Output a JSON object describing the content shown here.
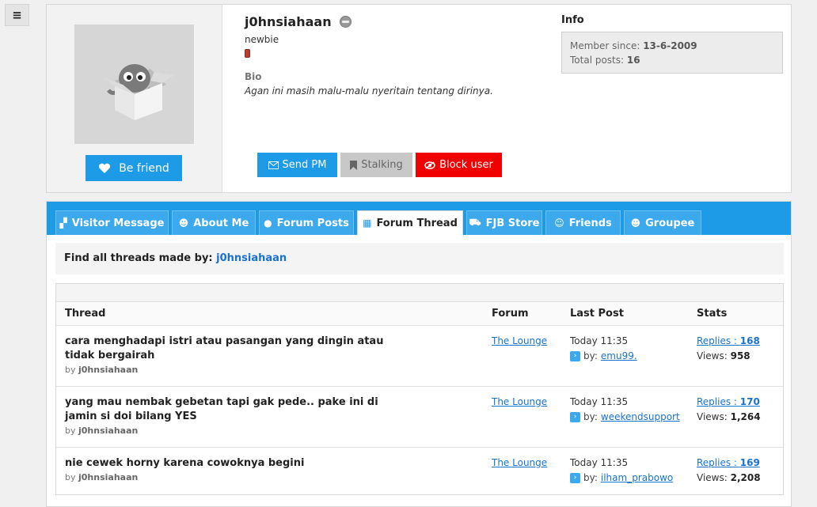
{
  "menu_icon": "menu-icon",
  "profile": {
    "username": "j0hnsiahaan",
    "rank": "newbie",
    "bio_label": "Bio",
    "bio_text": "Agan ini masih malu-malu nyeritain tentang dirinya.",
    "befriend_label": "Be friend",
    "actions": {
      "send_pm": "Send PM",
      "stalking": "Stalking",
      "block_user": "Block user"
    },
    "info_title": "Info",
    "member_since_label": "Member since: ",
    "member_since": "13-6-2009",
    "total_posts_label": "Total posts: ",
    "total_posts": "16",
    "colors": {
      "primary": "#1e9be6",
      "block": "#f00000",
      "stalk": "#c8c8c8"
    }
  },
  "tabs": [
    {
      "label": "Visitor Message",
      "icon": "message-icon"
    },
    {
      "label": "About Me",
      "icon": "user-icon"
    },
    {
      "label": "Forum Posts",
      "icon": "chat-icon"
    },
    {
      "label": "Forum Thread",
      "icon": "calendar-icon",
      "active": true
    },
    {
      "label": "FJB Store",
      "icon": "cart-icon"
    },
    {
      "label": "Friends",
      "icon": "friends-icon"
    },
    {
      "label": "Groupee",
      "icon": "group-icon"
    }
  ],
  "find": {
    "label": "Find all threads made by: ",
    "user": "j0hnsiahaan"
  },
  "table": {
    "headers": {
      "thread": "Thread",
      "forum": "Forum",
      "last_post": "Last Post",
      "stats": "Stats"
    },
    "rows": [
      {
        "title": "cara menghadapi istri atau pasangan yang dingin atau tidak bergairah",
        "by_label": "by ",
        "author": "j0hnsiahaan",
        "forum": "The Lounge",
        "last_time": "Today 11:35",
        "last_by_label": "by: ",
        "last_user": "emu99.",
        "replies_label": "Replies : ",
        "replies": "168",
        "views_label": "Views: ",
        "views": "958"
      },
      {
        "title": "yang mau nembak gebetan tapi gak pede.. pake ini di jamin si doi bilang YES",
        "by_label": "by ",
        "author": "j0hnsiahaan",
        "forum": "The Lounge",
        "last_time": "Today 11:35",
        "last_by_label": "by: ",
        "last_user": "weekendsupport",
        "replies_label": "Replies : ",
        "replies": "170",
        "views_label": "Views: ",
        "views": "1,264"
      },
      {
        "title": "nie cewek horny karena cowoknya begini",
        "by_label": "by ",
        "author": "j0hnsiahaan",
        "forum": "The Lounge",
        "last_time": "Today 11:35",
        "last_by_label": "by: ",
        "last_user": "ilham_prabowo",
        "replies_label": "Replies : ",
        "replies": "169",
        "views_label": "Views: ",
        "views": "2,208"
      }
    ]
  }
}
